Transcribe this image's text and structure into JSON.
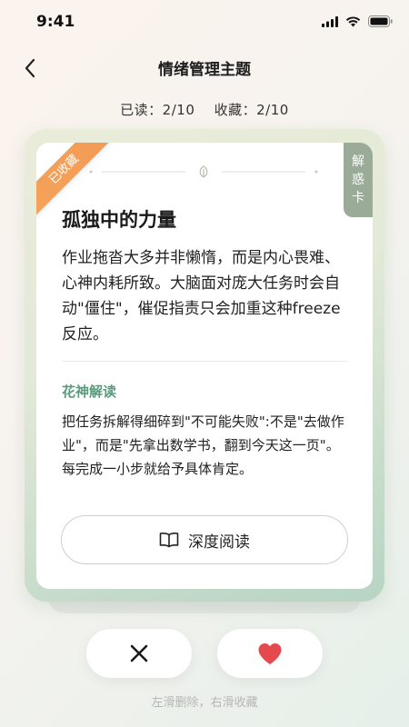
{
  "status": {
    "time": "9:41"
  },
  "nav": {
    "title": "情绪管理主题"
  },
  "stats": {
    "read": "已读：2/10",
    "favorites": "收藏：2/10"
  },
  "card": {
    "ribbon": "已收藏",
    "side_tab": [
      "解",
      "惑",
      "卡"
    ],
    "title": "孤独中的力量",
    "body": "作业拖沓大多并非懒惰，而是内心畏难、心神内耗所致。大脑面对庞大任务时会自动\"僵住\"，催促指责只会加重这种freeze反应。",
    "interp_label": "花神解读",
    "interp_body": "把任务拆解得细碎到\"不可能失败\":不是\"去做作业\"，而是\"先拿出数学书，翻到今天这一页\"。每完成一小步就给予具体肯定。",
    "read_button": "深度阅读"
  },
  "actions": {
    "hint": "左滑删除，右滑收藏"
  },
  "colors": {
    "accent_green": "#5b9a7d",
    "ribbon_orange": "#f29a55",
    "heart_red": "#e5484d"
  }
}
